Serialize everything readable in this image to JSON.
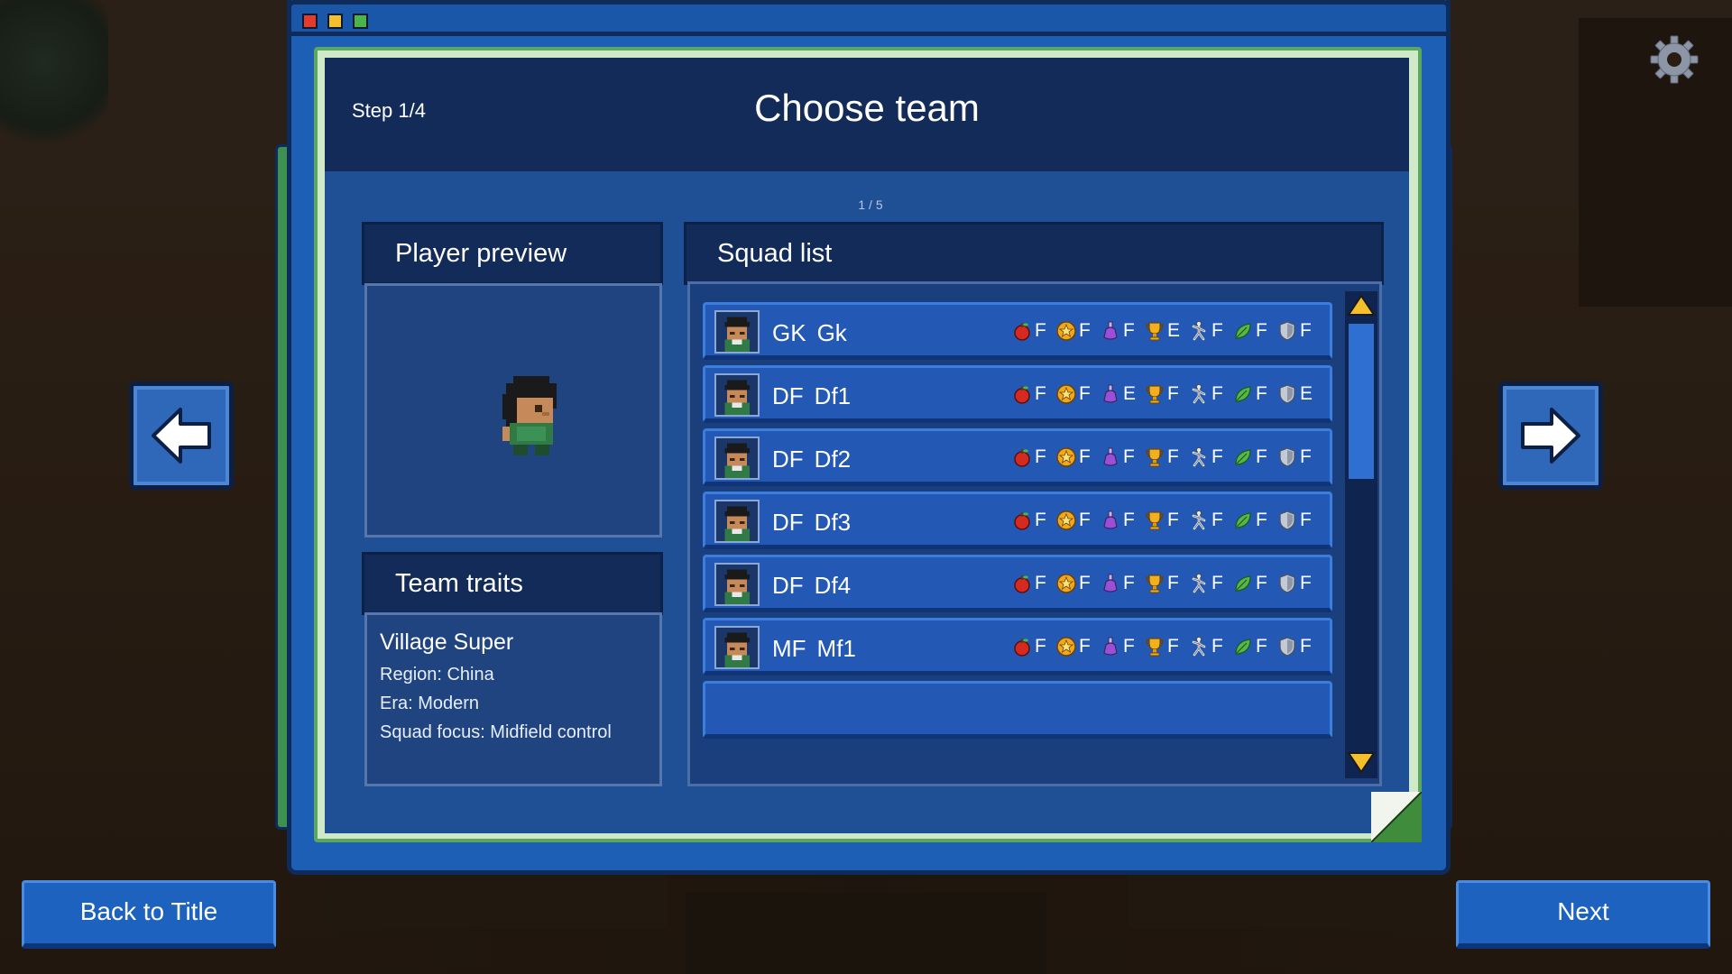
{
  "header": {
    "step": "Step 1/4",
    "title": "Choose team",
    "page_indicator": "1 / 5"
  },
  "player_preview": {
    "heading": "Player preview"
  },
  "team_traits": {
    "heading": "Team traits",
    "team_name": "Village Super",
    "region": "Region: China",
    "era": "Era: Modern",
    "squad_focus": "Squad focus: Midfield control"
  },
  "squad": {
    "heading": "Squad list",
    "stat_icons": [
      "apple-icon",
      "star-coin-icon",
      "potion-icon",
      "trophy-icon",
      "runner-icon",
      "leaf-icon",
      "shield-icon"
    ],
    "rows": [
      {
        "pos": "GK",
        "name": "Gk",
        "grades": [
          "F",
          "F",
          "F",
          "E",
          "F",
          "F",
          "F"
        ]
      },
      {
        "pos": "DF",
        "name": "Df1",
        "grades": [
          "F",
          "F",
          "E",
          "F",
          "F",
          "F",
          "E"
        ]
      },
      {
        "pos": "DF",
        "name": "Df2",
        "grades": [
          "F",
          "F",
          "F",
          "F",
          "F",
          "F",
          "F"
        ]
      },
      {
        "pos": "DF",
        "name": "Df3",
        "grades": [
          "F",
          "F",
          "F",
          "F",
          "F",
          "F",
          "F"
        ]
      },
      {
        "pos": "DF",
        "name": "Df4",
        "grades": [
          "F",
          "F",
          "F",
          "F",
          "F",
          "F",
          "F"
        ]
      },
      {
        "pos": "MF",
        "name": "Mf1",
        "grades": [
          "F",
          "F",
          "F",
          "F",
          "F",
          "F",
          "F"
        ]
      }
    ]
  },
  "buttons": {
    "back": "Back to Title",
    "next": "Next"
  },
  "colors": {
    "panel_blue": "#1f4f95",
    "header_navy": "#132b58",
    "row_blue": "#2358b4",
    "scroll_arrow_yellow": "#f5c02c",
    "frame_green": "#5aa75f"
  }
}
